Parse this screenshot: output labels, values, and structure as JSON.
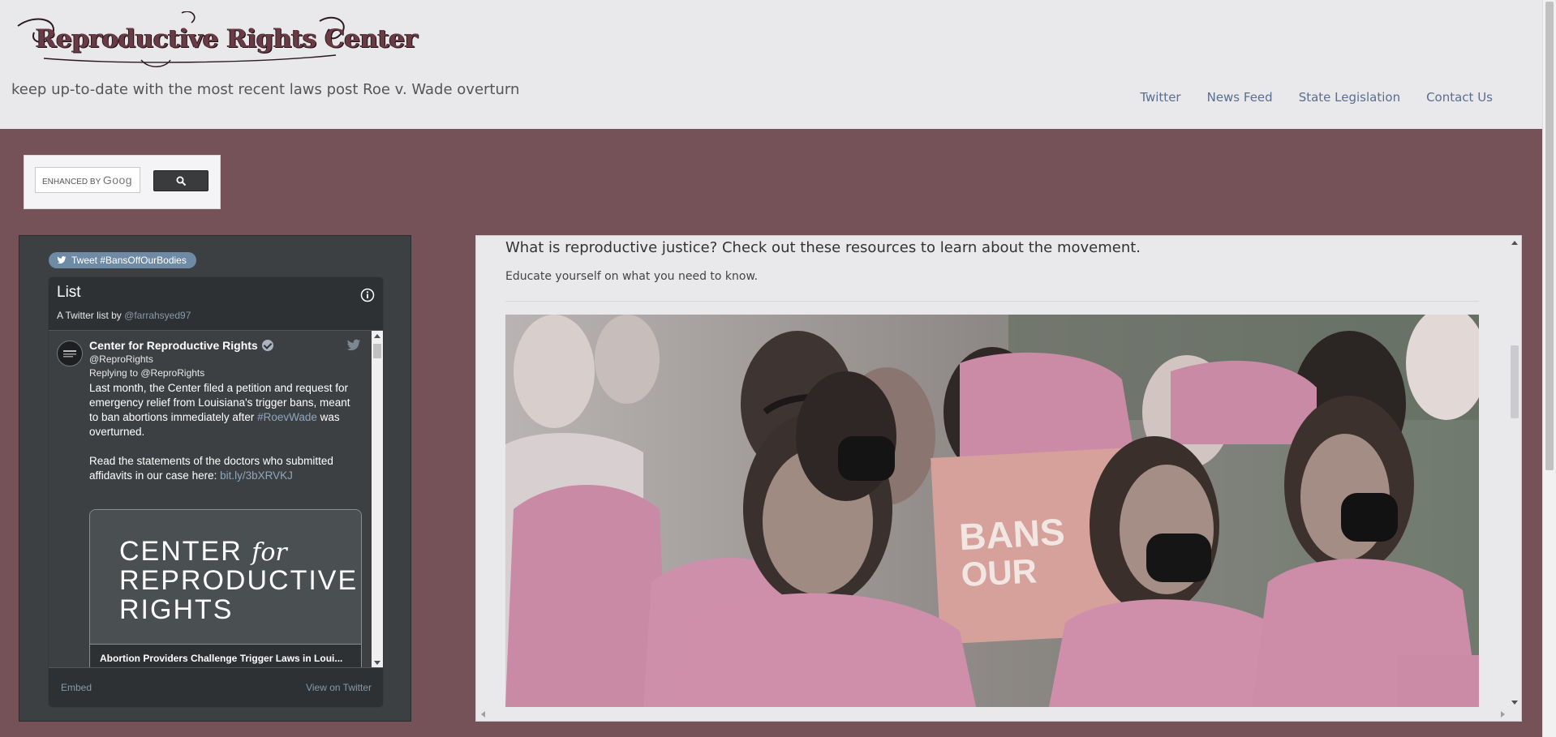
{
  "site": {
    "logo_text": "Reproductive Rights Center",
    "tagline": "keep up-to-date with the most recent laws post Roe v. Wade overturn"
  },
  "nav": {
    "items": [
      "Twitter",
      "News Feed",
      "State Legislation",
      "Contact Us"
    ]
  },
  "search": {
    "placeholder_prefix": "ENHANCED BY",
    "placeholder_brand": "Goog",
    "button_icon": "search-icon"
  },
  "twitter": {
    "tweet_button": "Tweet #BansOffOurBodies",
    "list_title": "List",
    "list_sub_prefix": "A Twitter list by",
    "list_owner": "@farrahsyed97",
    "tweet": {
      "author": "Center for Reproductive Rights",
      "handle": "@ReproRights",
      "replying_to": "Replying to @ReproRights",
      "text_1": "Last month, the Center filed a petition and request for emergency relief from Louisiana's trigger bans, meant to ban abortions immediately after ",
      "hashtag": "#RoevWade",
      "text_2": " was overturned.",
      "text_3": "Read the statements of the doctors who submitted affidavits in our case here: ",
      "link": "bit.ly/3bXRVKJ",
      "card_line1": "CENTER",
      "card_for": "for",
      "card_line2": "REPRODUCTIVE",
      "card_line3": "RIGHTS",
      "card_caption": "Abortion Providers Challenge Trigger Laws in Loui..."
    },
    "footer_embed": "Embed",
    "footer_view": "View on Twitter"
  },
  "resources": {
    "title": "What is reproductive justice? Check out these resources to learn about the movement.",
    "subtitle": "Educate yourself on what you need to know.",
    "photo_sign_1": "BANS",
    "photo_sign_2": "OUR"
  },
  "colors": {
    "page_bg": "#745257",
    "header_bg": "#e9e9ec",
    "nav_link": "#5a6e8e",
    "tweet_btn": "#6f8aa5",
    "shirt_pink": "#c98aa6"
  }
}
